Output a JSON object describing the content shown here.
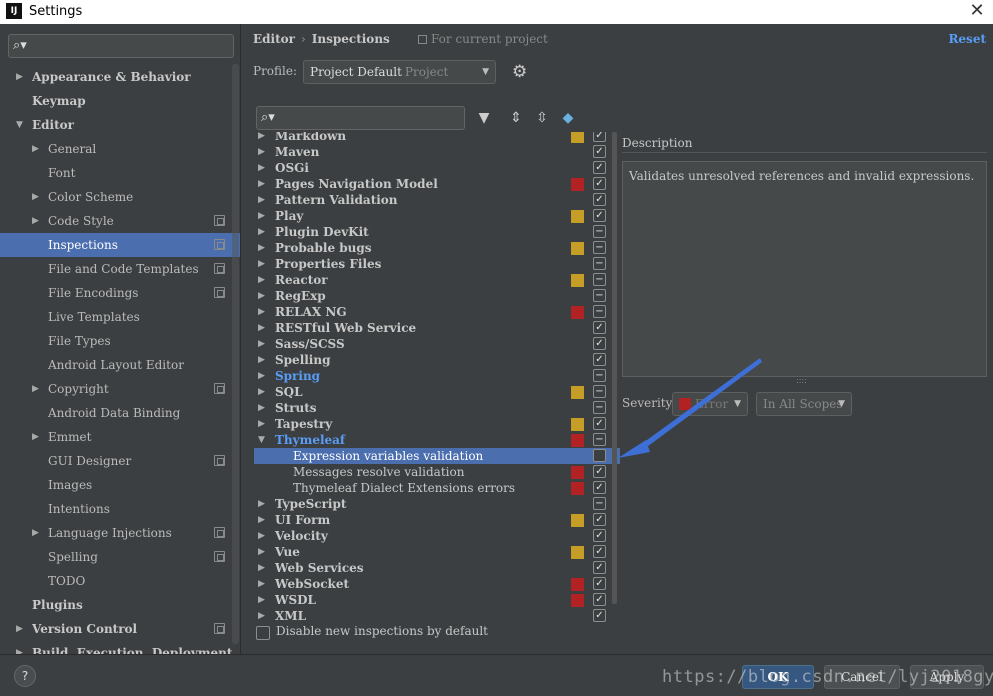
{
  "window": {
    "title": "Settings",
    "logo_text": "IJ",
    "close_glyph": "✕"
  },
  "left_panel": {
    "search_placeholder": "",
    "tree": [
      {
        "label": "Appearance & Behavior",
        "level": 0,
        "expandable": true,
        "expanded": false,
        "bold": true,
        "project": false
      },
      {
        "label": "Keymap",
        "level": 0,
        "expandable": false,
        "bold": true,
        "project": false
      },
      {
        "label": "Editor",
        "level": 0,
        "expandable": true,
        "expanded": true,
        "bold": true,
        "project": false
      },
      {
        "label": "General",
        "level": 1,
        "expandable": true,
        "expanded": false,
        "project": false
      },
      {
        "label": "Font",
        "level": 1,
        "expandable": false,
        "project": false
      },
      {
        "label": "Color Scheme",
        "level": 1,
        "expandable": true,
        "expanded": false,
        "project": false
      },
      {
        "label": "Code Style",
        "level": 1,
        "expandable": true,
        "expanded": false,
        "project": true
      },
      {
        "label": "Inspections",
        "level": 1,
        "expandable": false,
        "project": true,
        "selected": true
      },
      {
        "label": "File and Code Templates",
        "level": 1,
        "expandable": false,
        "project": true
      },
      {
        "label": "File Encodings",
        "level": 1,
        "expandable": false,
        "project": true
      },
      {
        "label": "Live Templates",
        "level": 1,
        "expandable": false,
        "project": false
      },
      {
        "label": "File Types",
        "level": 1,
        "expandable": false,
        "project": false
      },
      {
        "label": "Android Layout Editor",
        "level": 1,
        "expandable": false,
        "project": false
      },
      {
        "label": "Copyright",
        "level": 1,
        "expandable": true,
        "expanded": false,
        "project": true
      },
      {
        "label": "Android Data Binding",
        "level": 1,
        "expandable": false,
        "project": false
      },
      {
        "label": "Emmet",
        "level": 1,
        "expandable": true,
        "expanded": false,
        "project": false
      },
      {
        "label": "GUI Designer",
        "level": 1,
        "expandable": false,
        "project": true
      },
      {
        "label": "Images",
        "level": 1,
        "expandable": false,
        "project": false
      },
      {
        "label": "Intentions",
        "level": 1,
        "expandable": false,
        "project": false
      },
      {
        "label": "Language Injections",
        "level": 1,
        "expandable": true,
        "expanded": false,
        "project": true
      },
      {
        "label": "Spelling",
        "level": 1,
        "expandable": false,
        "project": true
      },
      {
        "label": "TODO",
        "level": 1,
        "expandable": false,
        "project": false
      },
      {
        "label": "Plugins",
        "level": 0,
        "expandable": false,
        "bold": true,
        "project": false
      },
      {
        "label": "Version Control",
        "level": 0,
        "expandable": true,
        "expanded": false,
        "bold": true,
        "project": true
      },
      {
        "label": "Build, Execution, Deployment",
        "level": 0,
        "expandable": true,
        "expanded": false,
        "bold": true,
        "project": false
      }
    ]
  },
  "header": {
    "breadcrumb": [
      "Editor",
      "Inspections"
    ],
    "breadcrumb_sep": "›",
    "for_current_project": "For current project",
    "reset": "Reset"
  },
  "profile": {
    "label": "Profile:",
    "value": "Project Default",
    "scope": "Project"
  },
  "inspections": [
    {
      "name": "Markdown",
      "severity": "warning",
      "check": "checked",
      "expandable": true
    },
    {
      "name": "Maven",
      "severity": "none",
      "check": "checked",
      "expandable": true
    },
    {
      "name": "OSGi",
      "severity": "none",
      "check": "checked",
      "expandable": true
    },
    {
      "name": "Pages Navigation Model",
      "severity": "error",
      "check": "checked",
      "expandable": true
    },
    {
      "name": "Pattern Validation",
      "severity": "none",
      "check": "checked",
      "expandable": true
    },
    {
      "name": "Play",
      "severity": "warning",
      "check": "checked",
      "expandable": true
    },
    {
      "name": "Plugin DevKit",
      "severity": "none",
      "check": "mixed",
      "expandable": true
    },
    {
      "name": "Probable bugs",
      "severity": "warning",
      "check": "mixed",
      "expandable": true
    },
    {
      "name": "Properties Files",
      "severity": "none",
      "check": "mixed",
      "expandable": true
    },
    {
      "name": "Reactor",
      "severity": "warning",
      "check": "mixed",
      "expandable": true
    },
    {
      "name": "RegExp",
      "severity": "none",
      "check": "mixed",
      "expandable": true
    },
    {
      "name": "RELAX NG",
      "severity": "error",
      "check": "mixed",
      "expandable": true
    },
    {
      "name": "RESTful Web Service",
      "severity": "none",
      "check": "checked",
      "expandable": true
    },
    {
      "name": "Sass/SCSS",
      "severity": "none",
      "check": "checked",
      "expandable": true
    },
    {
      "name": "Spelling",
      "severity": "none",
      "check": "checked",
      "expandable": true
    },
    {
      "name": "Spring",
      "severity": "none",
      "check": "mixed",
      "expandable": true,
      "highlight": true
    },
    {
      "name": "SQL",
      "severity": "warning",
      "check": "mixed",
      "expandable": true
    },
    {
      "name": "Struts",
      "severity": "none",
      "check": "mixed",
      "expandable": true
    },
    {
      "name": "Tapestry",
      "severity": "warning",
      "check": "checked",
      "expandable": true
    },
    {
      "name": "Thymeleaf",
      "severity": "error",
      "check": "mixed",
      "expandable": true,
      "expanded": true,
      "highlight": true
    },
    {
      "name": "Expression variables validation",
      "severity": "none",
      "check": "unchecked",
      "child": true,
      "selected": true
    },
    {
      "name": "Messages resolve validation",
      "severity": "error",
      "check": "checked",
      "child": true
    },
    {
      "name": "Thymeleaf Dialect Extensions errors",
      "severity": "error",
      "check": "checked",
      "child": true
    },
    {
      "name": "TypeScript",
      "severity": "none",
      "check": "mixed",
      "expandable": true
    },
    {
      "name": "UI Form",
      "severity": "warning",
      "check": "checked",
      "expandable": true
    },
    {
      "name": "Velocity",
      "severity": "none",
      "check": "checked",
      "expandable": true
    },
    {
      "name": "Vue",
      "severity": "warning",
      "check": "checked",
      "expandable": true
    },
    {
      "name": "Web Services",
      "severity": "none",
      "check": "checked",
      "expandable": true
    },
    {
      "name": "WebSocket",
      "severity": "error",
      "check": "checked",
      "expandable": true
    },
    {
      "name": "WSDL",
      "severity": "error",
      "check": "checked",
      "expandable": true
    },
    {
      "name": "XML",
      "severity": "none",
      "check": "checked",
      "expandable": true
    }
  ],
  "disable_new": "Disable new inspections by default",
  "description": {
    "title": "Description",
    "text": "Validates unresolved references and invalid expressions."
  },
  "severity": {
    "label": "Severity:",
    "value": "Error",
    "scope": "In All Scopes"
  },
  "footer": {
    "help": "?",
    "ok": "OK",
    "cancel": "Cancel",
    "apply": "Apply",
    "watermark": "https://blog.csdn.net/lyj2018gyq"
  },
  "colors": {
    "selection": "#4b6eaf",
    "warning": "#c59e28",
    "error": "#b22222",
    "link": "#589df6",
    "annotation_arrow": "#3d6fd6"
  },
  "icons": [
    "search-icon",
    "filter-icon",
    "expand-all-icon",
    "collapse-all-icon",
    "eraser-icon",
    "gear-icon",
    "project-scope-icon",
    "close-icon"
  ]
}
